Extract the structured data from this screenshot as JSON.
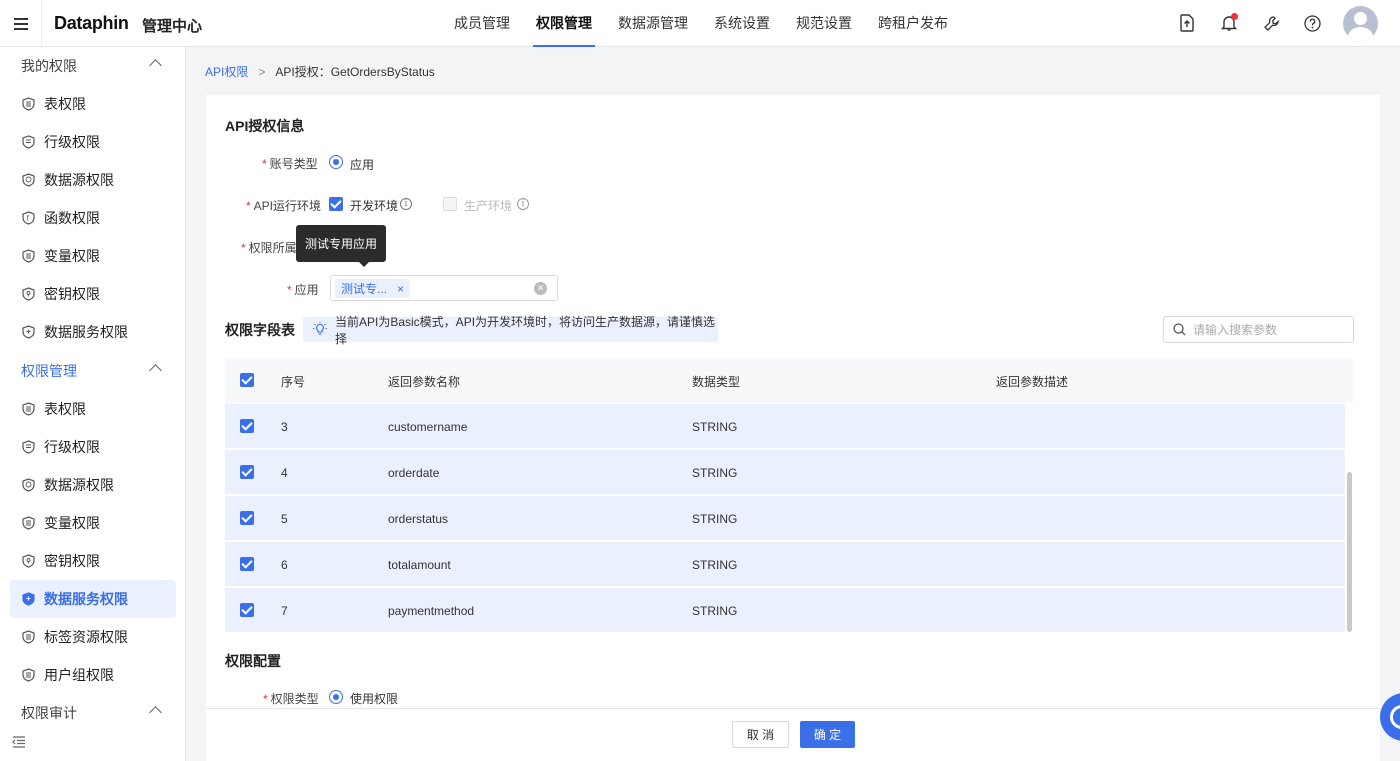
{
  "header": {
    "logo": "Dataphin",
    "logo_sub": "管理中心",
    "nav": [
      "成员管理",
      "权限管理",
      "数据源管理",
      "系统设置",
      "规范设置",
      "跨租户发布"
    ],
    "active_nav": "权限管理",
    "icons": [
      "upload-icon",
      "bell-icon",
      "wrench-icon",
      "help-icon"
    ]
  },
  "sidebar": {
    "group1": "我的权限",
    "group1_items": [
      "表权限",
      "行级权限",
      "数据源权限",
      "函数权限",
      "变量权限",
      "密钥权限",
      "数据服务权限"
    ],
    "group2": "权限管理",
    "group2_items": [
      "表权限",
      "行级权限",
      "数据源权限",
      "变量权限",
      "密钥权限",
      "数据服务权限",
      "标签资源权限",
      "用户组权限"
    ],
    "active_item": "数据服务权限",
    "group3": "权限审计"
  },
  "breadcrumb": {
    "link": "API权限",
    "sep": ">",
    "current": "API授权：GetOrdersByStatus"
  },
  "form": {
    "section_title": "API授权信息",
    "account_type_label": "账号类型",
    "account_type_value": "应用",
    "env_label": "API运行环境",
    "env_dev": "开发环境",
    "env_prod": "生产环境",
    "owner_label": "权限所属",
    "tooltip": "测试专用应用",
    "app_label": "应用",
    "app_tag": "测试专...",
    "app_tag_close": "×"
  },
  "fields": {
    "section_title": "权限字段表",
    "notice": "当前API为Basic模式，API为开发环境时，将访问生产数据源，请谨慎选择",
    "search_placeholder": "请输入搜索参数",
    "columns": [
      "序号",
      "返回参数名称",
      "数据类型",
      "返回参数描述"
    ],
    "rows": [
      {
        "no": "3",
        "name": "customername",
        "type": "STRING",
        "desc": ""
      },
      {
        "no": "4",
        "name": "orderdate",
        "type": "STRING",
        "desc": ""
      },
      {
        "no": "5",
        "name": "orderstatus",
        "type": "STRING",
        "desc": ""
      },
      {
        "no": "6",
        "name": "totalamount",
        "type": "STRING",
        "desc": ""
      },
      {
        "no": "7",
        "name": "paymentmethod",
        "type": "STRING",
        "desc": ""
      }
    ]
  },
  "config": {
    "section_title": "权限配置",
    "perm_type_label": "权限类型",
    "perm_type_value": "使用权限"
  },
  "footer": {
    "cancel": "取 消",
    "ok": "确 定"
  },
  "colors": {
    "accent": "#3a6fe8",
    "selected_row": "#eaf0fd",
    "required": "#e33333"
  }
}
